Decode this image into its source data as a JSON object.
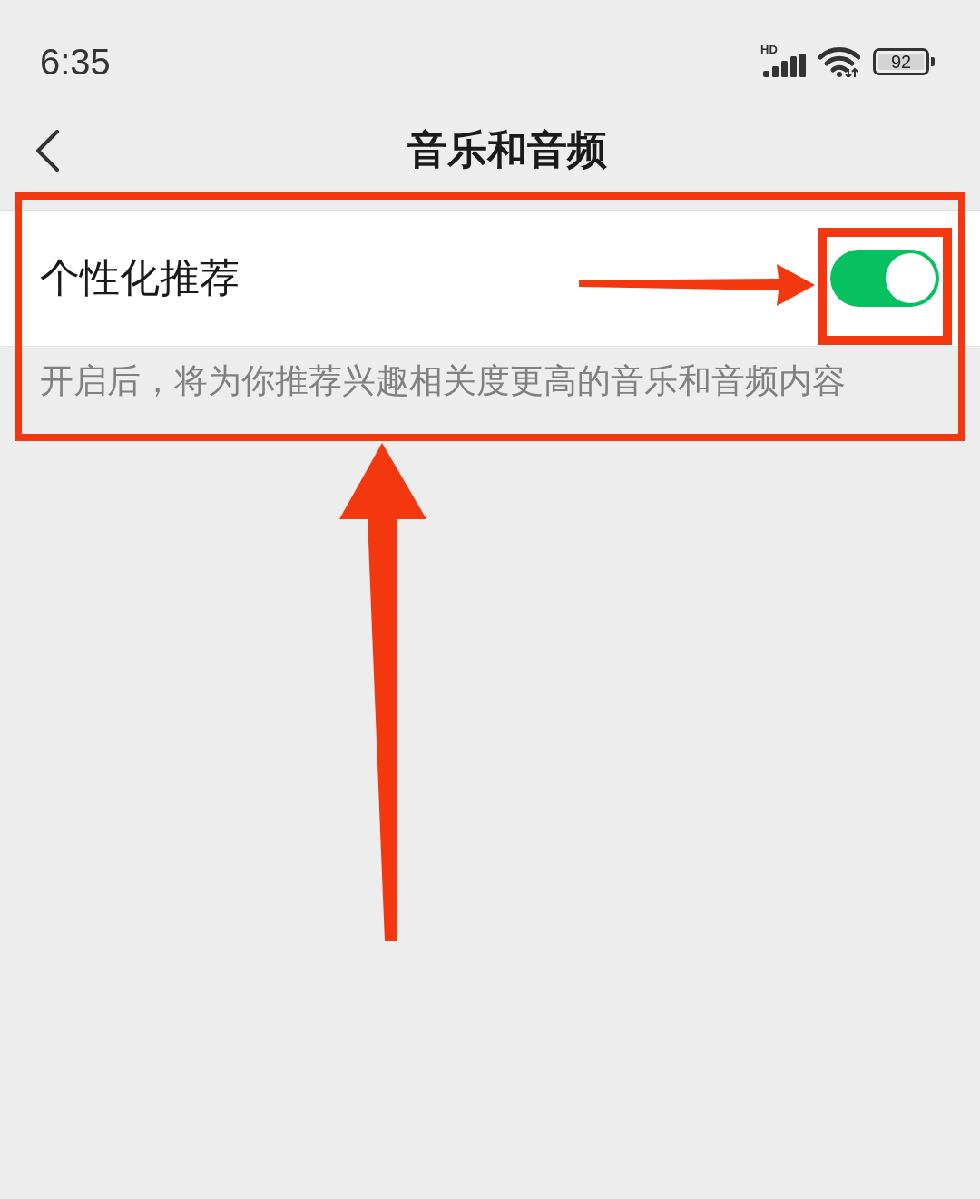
{
  "status_bar": {
    "time": "6:35",
    "network": "HD",
    "battery": "92"
  },
  "header": {
    "title": "音乐和音频"
  },
  "setting": {
    "label": "个性化推荐",
    "on": true,
    "description": "开启后，将为你推荐兴趣相关度更高的音乐和音频内容"
  }
}
